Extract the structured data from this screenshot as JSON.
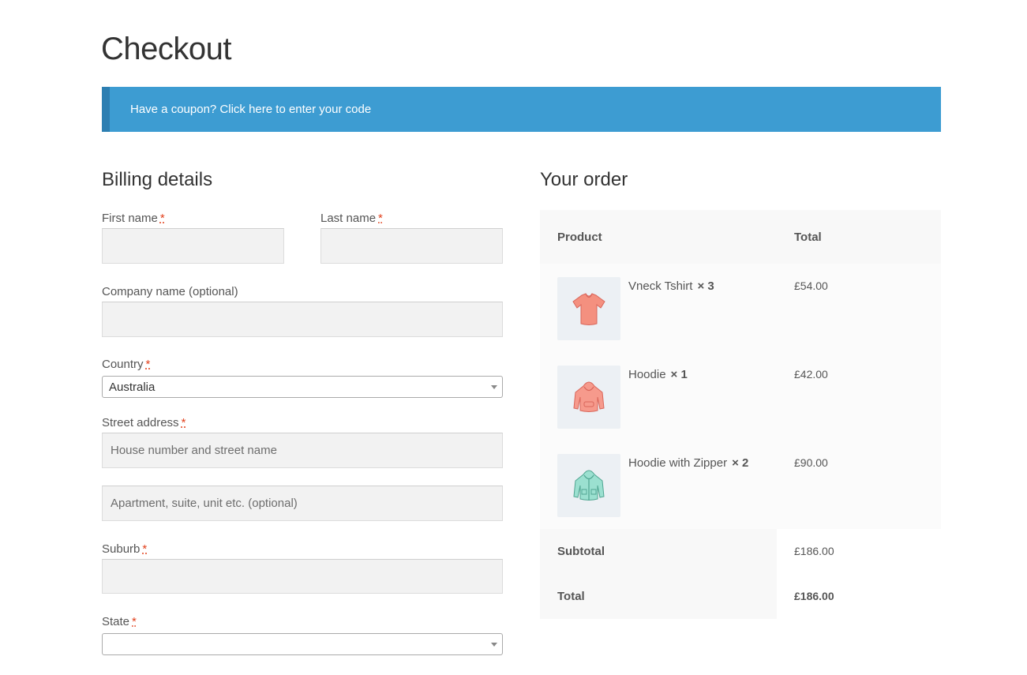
{
  "page": {
    "title": "Checkout"
  },
  "coupon": {
    "text": "Have a coupon? Click here to enter your code"
  },
  "billing": {
    "title": "Billing details",
    "required_mark": "*",
    "first_name": {
      "label": "First name",
      "value": ""
    },
    "last_name": {
      "label": "Last name",
      "value": ""
    },
    "company": {
      "label": "Company name (optional)",
      "value": ""
    },
    "country": {
      "label": "Country",
      "value": "Australia"
    },
    "street": {
      "label": "Street address",
      "placeholder1": "House number and street name",
      "placeholder2": "Apartment, suite, unit etc. (optional)"
    },
    "suburb": {
      "label": "Suburb",
      "value": ""
    },
    "state": {
      "label": "State",
      "value": ""
    }
  },
  "order": {
    "title": "Your order",
    "headers": {
      "product": "Product",
      "total": "Total"
    },
    "items": [
      {
        "name": "Vneck Tshirt",
        "qty": "× 3",
        "price": "£54.00",
        "icon": "tshirt-icon",
        "color": "#f08070"
      },
      {
        "name": "Hoodie",
        "qty": "× 1",
        "price": "£42.00",
        "icon": "hoodie-icon",
        "color": "#f0877a"
      },
      {
        "name": "Hoodie with Zipper",
        "qty": "× 2",
        "price": "£90.00",
        "icon": "zip-hoodie-icon",
        "color": "#8fd8c8"
      }
    ],
    "subtotal": {
      "label": "Subtotal",
      "value": "£186.00"
    },
    "total": {
      "label": "Total",
      "value": "£186.00"
    }
  },
  "colors": {
    "accent": "#3d9cd2",
    "required": "#e2401c"
  }
}
